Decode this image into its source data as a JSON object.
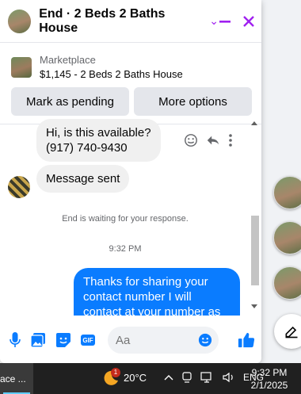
{
  "chat": {
    "title": "End · 2 Beds 2 Baths House"
  },
  "listing": {
    "source": "Marketplace",
    "title": "$1,145 - 2 Beds 2 Baths House"
  },
  "actions": {
    "pending_label": "Mark as pending",
    "more_label": "More options"
  },
  "messages": {
    "incoming_1_line1": "Hi, is this available?",
    "incoming_1_line2": "(917) 740-9430",
    "incoming_2": "Message sent",
    "waiting_note": "End is waiting for your response.",
    "timestamp": "9:32 PM",
    "outgoing_1": "Thanks for sharing your contact number I will contact at your number as"
  },
  "composer": {
    "placeholder": "Aa",
    "gif_label": "GIF"
  },
  "taskbar": {
    "app_label": "ace ...",
    "temperature": "20°C",
    "weather_badge": "1",
    "language": "ENG",
    "time": "9:32 PM",
    "date": "2/1/2025"
  },
  "colors": {
    "accent_purple": "#a020f0",
    "messenger_blue": "#0a7cff"
  }
}
